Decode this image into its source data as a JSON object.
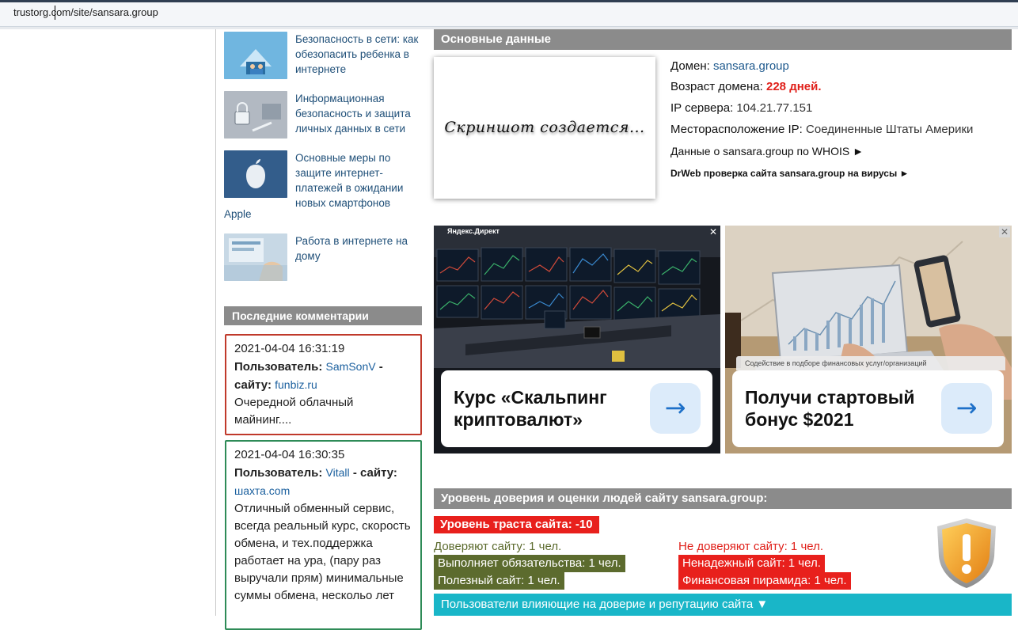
{
  "browser": {
    "url": "trustorg.com/site/sansara.group"
  },
  "sidebar": {
    "posts": [
      {
        "title": "Безопасность в сети: как обезопасить ребенка в интернете"
      },
      {
        "title": "Информационная безопасность и защита личных данных в сети"
      },
      {
        "title": "Основные меры по защите интернет-платежей в ожидании новых смартфонов",
        "tail": "Apple"
      },
      {
        "title": "Работа в интернете на дому"
      }
    ],
    "comments_header": "Последние комментарии",
    "comments": [
      {
        "date": "2021-04-04 16:31:19",
        "user_label": "Пользователь:",
        "user": "SamSonV",
        "site_label": "- сайту:",
        "site": "funbiz.ru",
        "text": "Очередной облачный майнинг....",
        "border": "#c0392b"
      },
      {
        "date": "2021-04-04 16:30:35",
        "user_label": "Пользователь:",
        "user": "Vitall",
        "site_label": "- сайту:",
        "site": "шахта.com",
        "text": "Отличный обменный сервис, всегда реальный курс, скорость обмена, и тех.поддержка работает на ура, (пару раз выручали прям) минимальные суммы обмена, нескольо лет",
        "border": "#2e8b57"
      }
    ]
  },
  "main": {
    "header": "Основные данные",
    "screenshot_text": "Скриншот создается...",
    "domain_label": "Домен:",
    "domain": "sansara.group",
    "age_label": "Возраст домена:",
    "age": "228 дней.",
    "ip_label": "IP сервера:",
    "ip": "104.21.77.151",
    "location_label": "Месторасположение IP:",
    "location": "Соединенные Штаты Америки",
    "whois_link": "Данные о sansara.group по WHOIS ►",
    "drweb_link": "DrWeb проверка сайта sansara.group на вирусы ►"
  },
  "ads": [
    {
      "label": "Яндекс.Директ",
      "headline_1": "Курс «Скальпинг",
      "headline_2": "криптовалют»",
      "arrow": "→"
    },
    {
      "note": "Содействие в подборе финансовых услуг/организаций",
      "headline_1": "Получи стартовый",
      "headline_2": "бонус $2021",
      "arrow": "→"
    }
  ],
  "trust": {
    "header": "Уровень доверия и оценки людей сайту sansara.group:",
    "level": "Уровень траста сайта: -10",
    "trust_count": "Доверяют сайту: 1 чел.",
    "distrust_count": "Не доверяют сайту: 1 чел.",
    "positive": [
      "Выполняет обязательства: 1 чел.",
      "Полезный сайт: 1 чел."
    ],
    "negative": [
      "Ненадежный сайт: 1 чел.",
      "Финансовая пирамида: 1 чел."
    ],
    "users_bar": "Пользователи влияющие на доверие и репутацию сайта ▼",
    "colors": {
      "negative": "#e8201c",
      "positive": "#5c6b2e",
      "bar": "#19b6c8"
    }
  }
}
